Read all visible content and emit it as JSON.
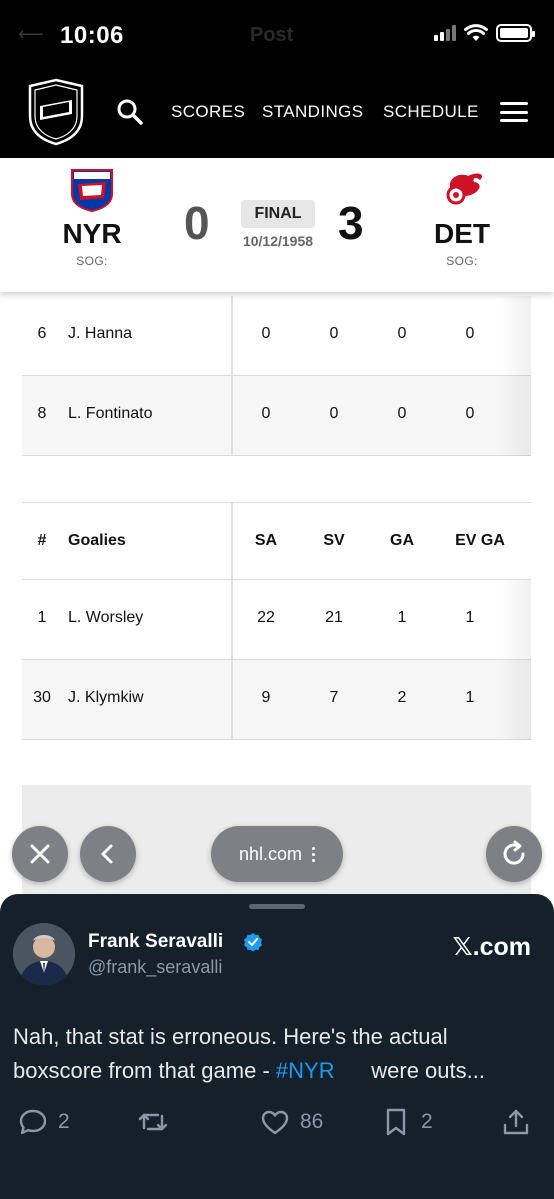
{
  "status_bar": {
    "time": "10:06",
    "back_hint": "⟵",
    "app_hint": "Post"
  },
  "nhl_nav": {
    "links": [
      "SCORES",
      "STANDINGS",
      "SCHEDULE"
    ]
  },
  "game": {
    "away": {
      "abbr": "NYR",
      "score": "0",
      "sog": "SOG:"
    },
    "home": {
      "abbr": "DET",
      "score": "3",
      "sog": "SOG:"
    },
    "status": "FINAL",
    "date": "10/12/1958"
  },
  "skaters": [
    {
      "num": "6",
      "name": "J. Hanna",
      "c1": "0",
      "c2": "0",
      "c3": "0",
      "c4": "0"
    },
    {
      "num": "8",
      "name": "L. Fontinato",
      "c1": "0",
      "c2": "0",
      "c3": "0",
      "c4": "0"
    }
  ],
  "goalies": {
    "headers": {
      "num": "#",
      "name": "Goalies",
      "c1": "SA",
      "c2": "SV",
      "c3": "GA",
      "c4": "EV GA"
    },
    "rows": [
      {
        "num": "1",
        "name": "L. Worsley",
        "c1": "22",
        "c2": "21",
        "c3": "1",
        "c4": "1"
      },
      {
        "num": "30",
        "name": "J. Klymkiw",
        "c1": "9",
        "c2": "7",
        "c3": "2",
        "c4": "1"
      }
    ]
  },
  "browser": {
    "url": "nhl.com"
  },
  "tweet": {
    "author": "Frank Seravalli",
    "handle": "@frank_seravalli",
    "site": "𝕏.com",
    "text_before": "Nah, that stat is erroneous. Here's the actual boxscore from that game - ",
    "hashtag": "#NYR",
    "text_after": "      were outs...",
    "replies": "2",
    "likes": "86",
    "bookmarks": "2"
  },
  "colors": {
    "brand_black": "#000000",
    "tweet_bg": "#15202b",
    "link_blue": "#1d9bf0",
    "rangers_blue": "#0038a8",
    "wings_red": "#ce1126"
  }
}
